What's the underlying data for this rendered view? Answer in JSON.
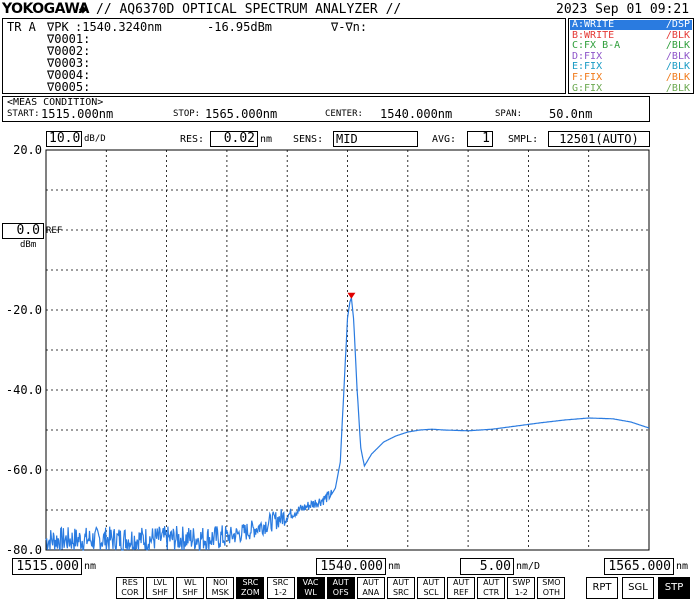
{
  "header": {
    "brand": "YOKOGAWA",
    "model": "// AQ6370D OPTICAL SPECTRUM ANALYZER //",
    "datetime": "2023 Sep 01 09:21"
  },
  "marker": {
    "tr_label": "TR A",
    "vpk_label": "∇PK",
    "vpk_wl": ":1540.3240nm",
    "vpk_level": "-16.95dBm",
    "delta_label": "∇-∇n:",
    "list": [
      "∇0001:",
      "∇0002:",
      "∇0003:",
      "∇0004:",
      "∇0005:"
    ]
  },
  "traces": [
    {
      "label": "A:WRITE",
      "mode": "/DSP",
      "color": "#2a7be0",
      "selected": true
    },
    {
      "label": "B:WRITE",
      "mode": "/BLK",
      "color": "#e53935",
      "selected": false
    },
    {
      "label": "C:FX B-A",
      "mode": "/BLK",
      "color": "#2e9e3a",
      "selected": false
    },
    {
      "label": "D:FIX",
      "mode": "/BLK",
      "color": "#8e55c9",
      "selected": false
    },
    {
      "label": "E:FIX",
      "mode": "/BLK",
      "color": "#1a9bc4",
      "selected": false
    },
    {
      "label": "F:FIX",
      "mode": "/BLK",
      "color": "#f07a1a",
      "selected": false
    },
    {
      "label": "G:FIX",
      "mode": "/BLK",
      "color": "#6aa84f",
      "selected": false
    }
  ],
  "meas": {
    "title": "<MEAS CONDITION>",
    "start_label": "START:",
    "start": "1515.000nm",
    "stop_label": "STOP:",
    "stop": "1565.000nm",
    "center_label": "CENTER:",
    "center": "1540.000nm",
    "span_label": "SPAN:",
    "span": "50.0nm"
  },
  "settings": {
    "scale": "10.0",
    "scale_unit": "dB/D",
    "res_label": "RES:",
    "res": "0.02",
    "res_unit": "nm",
    "sens_label": "SENS:",
    "sens": "MID",
    "avg_label": "AVG:",
    "avg": "1",
    "smpl_label": "SMPL:",
    "smpl": "12501(AUTO)"
  },
  "ref": {
    "value": "0.0",
    "label": "REF",
    "unit": "dBm"
  },
  "bottom": {
    "start": "1515.000",
    "center": "1540.000",
    "unit": "nm",
    "div": "5.00",
    "div_unit": "nm/D",
    "stop": "1565.000"
  },
  "softkeys": [
    {
      "l1": "RES",
      "l2": "COR",
      "on": false
    },
    {
      "l1": "LVL",
      "l2": "SHF",
      "on": false
    },
    {
      "l1": "WL",
      "l2": "SHF",
      "on": false
    },
    {
      "l1": "NOI",
      "l2": "MSK",
      "on": false
    },
    {
      "l1": "SRC",
      "l2": "ZOM",
      "on": true
    },
    {
      "l1": "SRC",
      "l2": "1-2",
      "on": false
    },
    {
      "l1": "VAC",
      "l2": "WL",
      "on": true
    },
    {
      "l1": "AUT",
      "l2": "OFS",
      "on": true
    },
    {
      "l1": "AUT",
      "l2": "ANA",
      "on": false
    },
    {
      "l1": "AUT",
      "l2": "SRC",
      "on": false
    },
    {
      "l1": "AUT",
      "l2": "SCL",
      "on": false
    },
    {
      "l1": "AUT",
      "l2": "REF",
      "on": false
    },
    {
      "l1": "AUT",
      "l2": "CTR",
      "on": false
    },
    {
      "l1": "SWP",
      "l2": "1-2",
      "on": false
    },
    {
      "l1": "SMO",
      "l2": "OTH",
      "on": false
    }
  ],
  "run_buttons": [
    {
      "label": "RPT",
      "on": false
    },
    {
      "label": "SGL",
      "on": false
    },
    {
      "label": "STP",
      "on": true
    }
  ],
  "chart_data": {
    "type": "line",
    "xlabel": "nm",
    "ylabel": "dBm",
    "xlim": [
      1515,
      1565
    ],
    "ylim": [
      -80,
      20
    ],
    "grid": true,
    "ytick_labels": [
      "20.0",
      "-20.0",
      "-40.0",
      "-60.0",
      "-80.0"
    ],
    "ytick_values": [
      20,
      -20,
      -40,
      -60,
      -80
    ],
    "series": [
      {
        "color": "#2a7be0",
        "x": [
          1515.0,
          1518.0,
          1521.0,
          1524.0,
          1527.0,
          1529.0,
          1530.0,
          1531.0,
          1532.0,
          1533.0,
          1534.0,
          1535.0,
          1536.0,
          1537.0,
          1538.0,
          1538.7,
          1539.0,
          1539.4,
          1539.7,
          1540.0,
          1540.2,
          1540.32,
          1540.5,
          1540.8,
          1541.1,
          1541.4,
          1541.7,
          1542.0,
          1542.5,
          1543.0,
          1544.0,
          1545.0,
          1546.0,
          1547.0,
          1548.0,
          1550.0,
          1552.0,
          1554.0,
          1556.0,
          1558.0,
          1560.0,
          1562.0,
          1563.5,
          1565.0
        ],
        "y": [
          -77.5,
          -77.4,
          -77.3,
          -77.2,
          -77.1,
          -77.0,
          -76.7,
          -76.0,
          -75.0,
          -73.8,
          -72.6,
          -71.3,
          -70.0,
          -68.6,
          -67.4,
          -66.0,
          -64.5,
          -58.0,
          -40.0,
          -22.0,
          -18.0,
          -16.95,
          -22.0,
          -40.0,
          -54.5,
          -59.0,
          -57.5,
          -56.0,
          -54.5,
          -53.0,
          -51.5,
          -50.5,
          -50.0,
          -49.8,
          -50.0,
          -50.2,
          -49.8,
          -49.0,
          -48.2,
          -47.5,
          -47.0,
          -47.2,
          -48.0,
          -49.5
        ]
      }
    ],
    "peak": {
      "x": 1540.324,
      "y": -16.95
    }
  }
}
